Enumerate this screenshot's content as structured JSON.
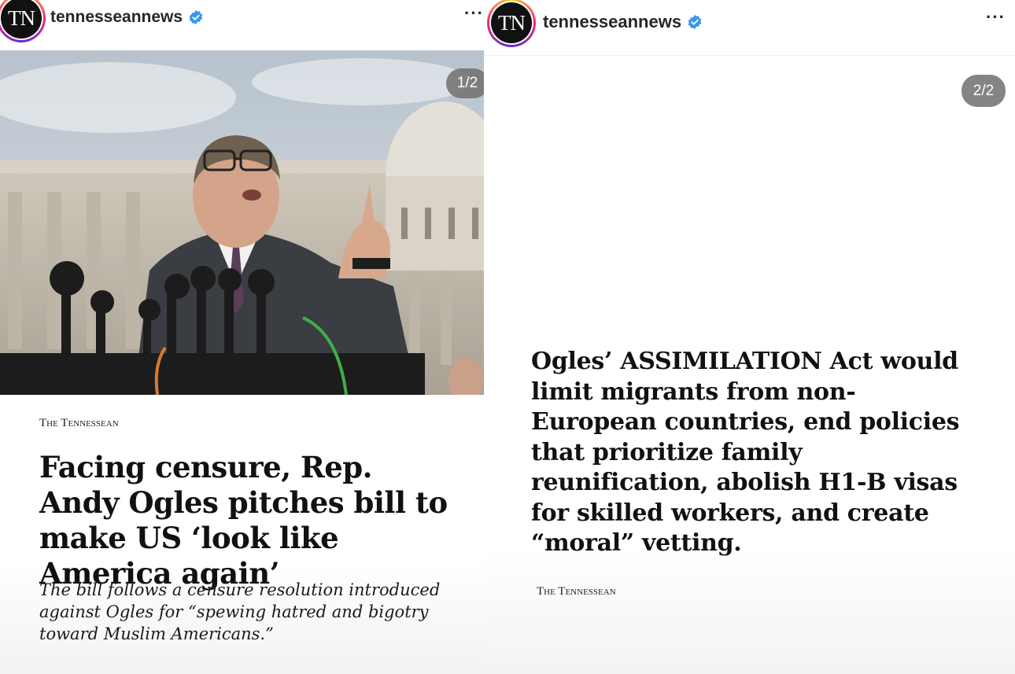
{
  "left_post": {
    "avatar_text": "TN",
    "username": "tennesseannews",
    "more_label": "···",
    "slide_counter": "1/2",
    "source_label": "The Tennessean",
    "headline": "Facing censure, Rep. Andy Ogles pitches bill to make US ‘look like America again’",
    "dek": "The bill follows a censure resolution introduced against Ogles for “spewing hatred and bigotry toward Muslim Americans.”"
  },
  "right_post": {
    "avatar_text": "TN",
    "username": "tennesseannews",
    "more_label": "···",
    "slide_counter": "2/2",
    "body": "Ogles’ ASSIMILATION Act would limit migrants from non-European countries, end policies that prioritize family reunification, abolish H1-B visas for skilled workers, and create “moral” vetting.",
    "source_label": "The Tennessean"
  },
  "colors": {
    "verified_badge": "#3897f0",
    "counter_bg": "#6e6e6e",
    "text": "#111111"
  },
  "icons": [
    "verified-badge-icon",
    "more-options-icon"
  ]
}
